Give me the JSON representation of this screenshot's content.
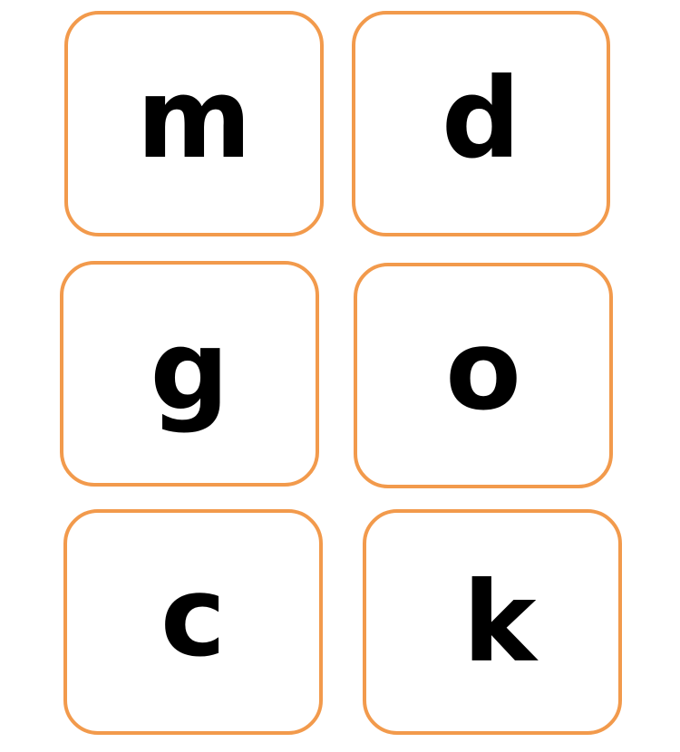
{
  "accent_color": "#f29a4c",
  "cards": [
    {
      "letter": "m"
    },
    {
      "letter": "d"
    },
    {
      "letter": "g"
    },
    {
      "letter": "o"
    },
    {
      "letter": "c"
    },
    {
      "letter": "k"
    }
  ]
}
